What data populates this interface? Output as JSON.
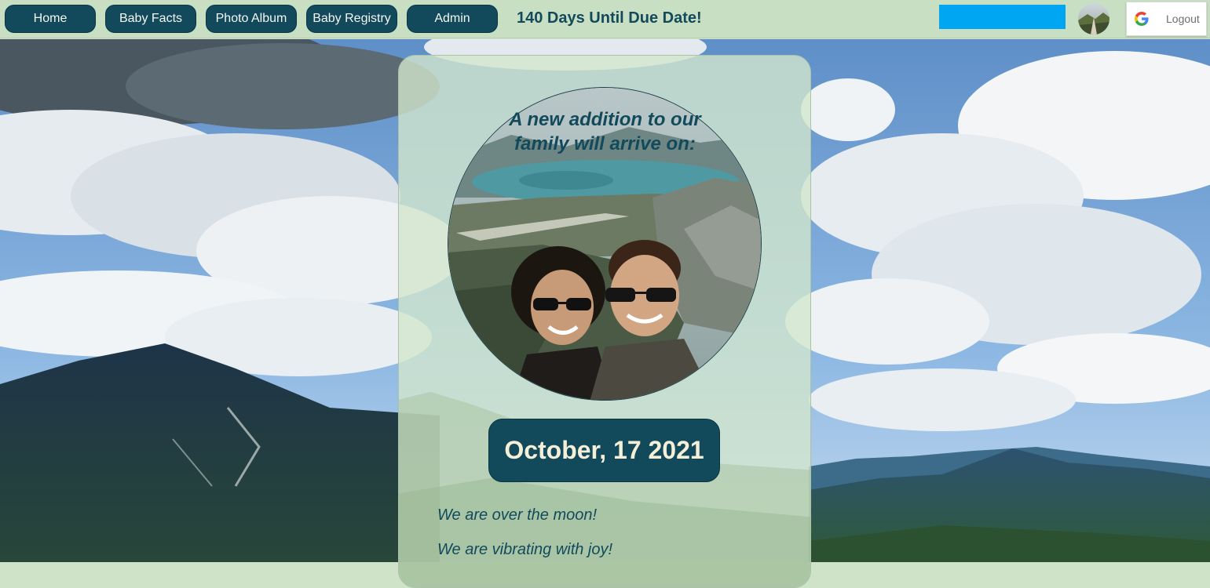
{
  "nav": {
    "items": [
      {
        "label": "Home"
      },
      {
        "label": "Baby Facts"
      },
      {
        "label": "Photo Album"
      },
      {
        "label": "Baby Registry"
      },
      {
        "label": "Admin"
      }
    ],
    "countdown": "140 Days Until Due Date!",
    "logout_label": "Logout"
  },
  "card": {
    "headline": "A new addition to our family will arrive on:",
    "due_date": "October, 17 2021",
    "messages": [
      "We are over the moon!",
      "We are vibrating with joy!"
    ]
  },
  "colors": {
    "nav_button": "#124a5c",
    "nav_bar": "#c9dfc4",
    "accent_blue": "#00a6f2",
    "date_text": "#f6efd8"
  },
  "icons": {
    "auth_provider": "google-icon"
  }
}
